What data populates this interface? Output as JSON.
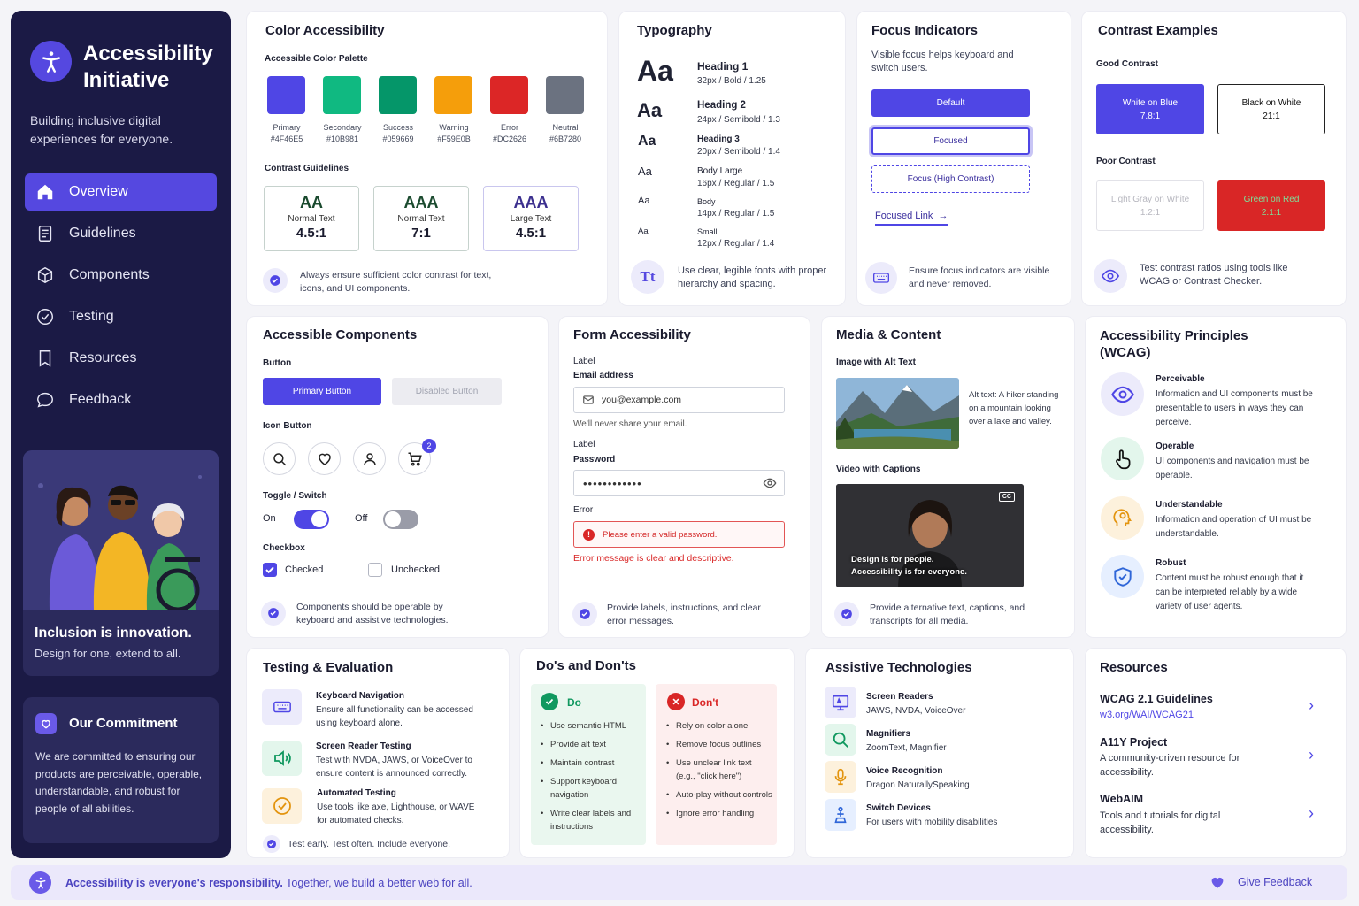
{
  "sidebar": {
    "title": "Accessibility Initiative",
    "tagline": "Building inclusive digital experiences for everyone.",
    "nav": [
      {
        "label": "Overview",
        "icon": "home-icon"
      },
      {
        "label": "Guidelines",
        "icon": "document-icon"
      },
      {
        "label": "Components",
        "icon": "cube-icon"
      },
      {
        "label": "Testing",
        "icon": "check-circle-icon"
      },
      {
        "label": "Resources",
        "icon": "bookmark-icon"
      },
      {
        "label": "Feedback",
        "icon": "chat-icon"
      }
    ],
    "promo_title": "Inclusion is innovation.",
    "promo_sub": "Design for one, extend to all.",
    "commitment_title": "Our Commitment",
    "commitment_text": "We are committed to ensuring our products are perceivable, operable, understandable, and robust for people of all abilities."
  },
  "color": {
    "title": "Color Accessibility",
    "palette_label": "Accessible Color Palette",
    "swatches": [
      {
        "name": "Primary",
        "hex": "#4F46E5"
      },
      {
        "name": "Secondary",
        "hex": "#10B981"
      },
      {
        "name": "Success",
        "hex": "#059669"
      },
      {
        "name": "Warning",
        "hex": "#F59E0B"
      },
      {
        "name": "Error",
        "hex": "#DC2626"
      },
      {
        "name": "Neutral",
        "hex": "#6B7280"
      }
    ],
    "guidelines_label": "Contrast Guidelines",
    "boxes": [
      {
        "level": "AA",
        "type": "Normal Text",
        "ratio": "4.5:1"
      },
      {
        "level": "AAA",
        "type": "Normal Text",
        "ratio": "7:1"
      },
      {
        "level": "AAA",
        "type": "Large Text",
        "ratio": "4.5:1"
      }
    ],
    "tip": "Always ensure sufficient color contrast for text, icons, and UI components."
  },
  "typography": {
    "title": "Typography",
    "rows": [
      {
        "sample": "Aa",
        "name": "Heading 1",
        "spec": "32px / Bold / 1.25"
      },
      {
        "sample": "Aa",
        "name": "Heading 2",
        "spec": "24px / Semibold / 1.3"
      },
      {
        "sample": "Aa",
        "name": "Heading 3",
        "spec": "20px / Semibold / 1.4"
      },
      {
        "sample": "Aa",
        "name": "Body Large",
        "spec": "16px / Regular / 1.5"
      },
      {
        "sample": "Aa",
        "name": "Body",
        "spec": "14px / Regular / 1.5"
      },
      {
        "sample": "Aa",
        "name": "Small",
        "spec": "12px / Regular / 1.4"
      }
    ],
    "badge": "Tt",
    "tip": "Use clear, legible fonts with proper hierarchy and spacing."
  },
  "focus": {
    "title": "Focus Indicators",
    "desc": "Visible focus helps keyboard and switch users.",
    "default": "Default",
    "focused": "Focused",
    "high": "Focus (High Contrast)",
    "link": "Focused Link",
    "tip": "Ensure focus indicators are visible and never removed."
  },
  "contrast": {
    "title": "Contrast Examples",
    "good_label": "Good Contrast",
    "good": [
      {
        "name": "White on Blue",
        "ratio": "7.8:1"
      },
      {
        "name": "Black on White",
        "ratio": "21:1"
      }
    ],
    "poor_label": "Poor Contrast",
    "poor": [
      {
        "name": "Light Gray on White",
        "ratio": "1.2:1"
      },
      {
        "name": "Green on Red",
        "ratio": "2.1:1"
      }
    ],
    "tip": "Test contrast ratios using tools like WCAG or Contrast Checker."
  },
  "components": {
    "title": "Accessible Components",
    "button_label": "Button",
    "primary": "Primary Button",
    "disabled": "Disabled Button",
    "icon_label": "Icon Button",
    "cart_badge": "2",
    "toggle_label": "Toggle / Switch",
    "on": "On",
    "off": "Off",
    "checkbox_label": "Checkbox",
    "checked": "Checked",
    "unchecked": "Unchecked",
    "tip": "Components should be operable by keyboard and assistive technologies."
  },
  "form": {
    "title": "Form Accessibility",
    "label1": "Label",
    "email_label": "Email address",
    "email_value": "you@example.com",
    "hint": "We'll never share your email.",
    "label2": "Label",
    "password_label": "Password",
    "password_value": "••••••••••••",
    "error_label": "Error",
    "error_text": "Please enter a valid password.",
    "error_note": "Error message is clear and descriptive.",
    "tip": "Provide labels, instructions, and clear error messages."
  },
  "media": {
    "title": "Media & Content",
    "image_label": "Image with Alt Text",
    "alt_text": "Alt text: A hiker standing on a mountain looking over a lake and valley.",
    "video_label": "Video with Captions",
    "cc": "CC",
    "caption1": "Design is for people.",
    "caption2": "Accessibility is for everyone.",
    "tip": "Provide alternative text, captions, and transcripts for all media."
  },
  "principles": {
    "title": "Accessibility Principles (WCAG)",
    "items": [
      {
        "name": "Perceivable",
        "desc": "Information and UI components must be presentable to users in ways they can perceive."
      },
      {
        "name": "Operable",
        "desc": "UI components and navigation must be operable."
      },
      {
        "name": "Understandable",
        "desc": "Information and operation of UI must be understandable."
      },
      {
        "name": "Robust",
        "desc": "Content must be robust enough that it can be interpreted reliably by a wide variety of user agents."
      }
    ]
  },
  "testing": {
    "title": "Testing & Evaluation",
    "items": [
      {
        "name": "Keyboard Navigation",
        "desc": "Ensure all functionality can be accessed using keyboard alone."
      },
      {
        "name": "Screen Reader Testing",
        "desc": "Test with NVDA, JAWS, or VoiceOver to ensure content is announced correctly."
      },
      {
        "name": "Automated Testing",
        "desc": "Use tools like axe, Lighthouse, or WAVE for automated checks."
      }
    ],
    "tip": "Test early. Test often. Include everyone."
  },
  "dos": {
    "title": "Do's and Don'ts",
    "do_label": "Do",
    "do": [
      "Use semantic HTML",
      "Provide alt text",
      "Maintain contrast",
      "Support keyboard navigation",
      "Write clear labels and instructions"
    ],
    "dont_label": "Don't",
    "dont": [
      "Rely on color alone",
      "Remove focus outlines",
      "Use unclear link text (e.g., \"click here\")",
      "Auto-play without controls",
      "Ignore error handling"
    ]
  },
  "assistive": {
    "title": "Assistive Technologies",
    "items": [
      {
        "name": "Screen Readers",
        "desc": "JAWS, NVDA, VoiceOver"
      },
      {
        "name": "Magnifiers",
        "desc": "ZoomText, Magnifier"
      },
      {
        "name": "Voice Recognition",
        "desc": "Dragon NaturallySpeaking"
      },
      {
        "name": "Switch Devices",
        "desc": "For users with mobility disabilities"
      }
    ]
  },
  "resources": {
    "title": "Resources",
    "items": [
      {
        "name": "WCAG 2.1 Guidelines",
        "desc": "w3.org/WAI/WCAG21"
      },
      {
        "name": "A11Y Project",
        "desc": "A community-driven resource for accessibility."
      },
      {
        "name": "WebAIM",
        "desc": "Tools and tutorials for digital accessibility."
      }
    ]
  },
  "footer": {
    "bold": "Accessibility is everyone's responsibility.",
    "rest": "Together, we build a better web for all.",
    "feedback": "Give Feedback"
  }
}
